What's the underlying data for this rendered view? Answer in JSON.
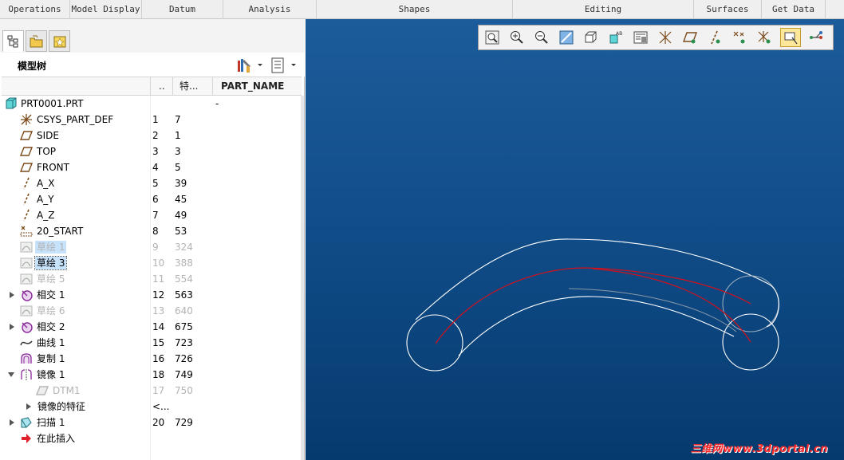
{
  "menu": {
    "operations": "Operations",
    "model_display": "Model Display",
    "datum": "Datum",
    "analysis": "Analysis",
    "shapes": "Shapes",
    "editing": "Editing",
    "surfaces": "Surfaces",
    "get_data": "Get Data"
  },
  "panel": {
    "tabs": [
      "model-tree-icon",
      "folder-browser-icon",
      "favorites-icon"
    ],
    "tree_title": "模型树",
    "tools": [
      "settings-tools-icon",
      "tree-columns-icon"
    ]
  },
  "columns": {
    "c1": "..",
    "c2": "特...",
    "c3": "PART_NAME"
  },
  "tree": {
    "root": {
      "name": "PRT0001.PRT",
      "c3": "-"
    },
    "csys": {
      "name": "CSYS_PART_DEF",
      "c1": "1",
      "c2": "7"
    },
    "side": {
      "name": "SIDE",
      "c1": "2",
      "c2": "1"
    },
    "top": {
      "name": "TOP",
      "c1": "3",
      "c2": "3"
    },
    "front": {
      "name": "FRONT",
      "c1": "4",
      "c2": "5"
    },
    "ax": {
      "name": "A_X",
      "c1": "5",
      "c2": "39"
    },
    "ay": {
      "name": "A_Y",
      "c1": "6",
      "c2": "45"
    },
    "az": {
      "name": "A_Z",
      "c1": "7",
      "c2": "49"
    },
    "start": {
      "name": "20_START",
      "c1": "8",
      "c2": "53"
    },
    "sketch1": {
      "name": "草绘 1",
      "c1": "9",
      "c2": "324"
    },
    "sketch3": {
      "name": "草绘 3",
      "c1": "10",
      "c2": "388"
    },
    "sketch5": {
      "name": "草绘 5",
      "c1": "11",
      "c2": "554"
    },
    "intersect1": {
      "name": "相交 1",
      "c1": "12",
      "c2": "563"
    },
    "sketch6": {
      "name": "草绘 6",
      "c1": "13",
      "c2": "640"
    },
    "intersect2": {
      "name": "相交 2",
      "c1": "14",
      "c2": "675"
    },
    "curve1": {
      "name": "曲线 1",
      "c1": "15",
      "c2": "723"
    },
    "copy1": {
      "name": "复制 1",
      "c1": "16",
      "c2": "726"
    },
    "mirror1": {
      "name": "镜像 1",
      "c1": "18",
      "c2": "749"
    },
    "dtm1": {
      "name": "DTM1",
      "c1": "17",
      "c2": "750"
    },
    "mirror_feat": {
      "name": "镜像的特征",
      "c1": "<..."
    },
    "sweep1": {
      "name": "扫描 1",
      "c1": "20",
      "c2": "729"
    },
    "insert_here": {
      "name": "在此插入"
    }
  },
  "viewbar": {
    "buttons": [
      "refit-icon",
      "zoom-in-icon",
      "zoom-out-icon",
      "repaint-icon",
      "saved-views-icon",
      "view-manager-icon",
      "display-style-icon",
      "csys-display-icon",
      "plane-display-icon",
      "axis-display-icon",
      "point-display-icon",
      "csys-toggle-icon",
      "annotation-toggle-icon",
      "spin-center-icon"
    ]
  },
  "watermark": "三维网www.3dportal.cn",
  "colors": {
    "viewport_top": "#1c5c9a",
    "viewport_bottom": "#053a6e",
    "selection": "#c7e2fb",
    "curve_white": "#ffffff",
    "curve_red": "#d4111b"
  }
}
